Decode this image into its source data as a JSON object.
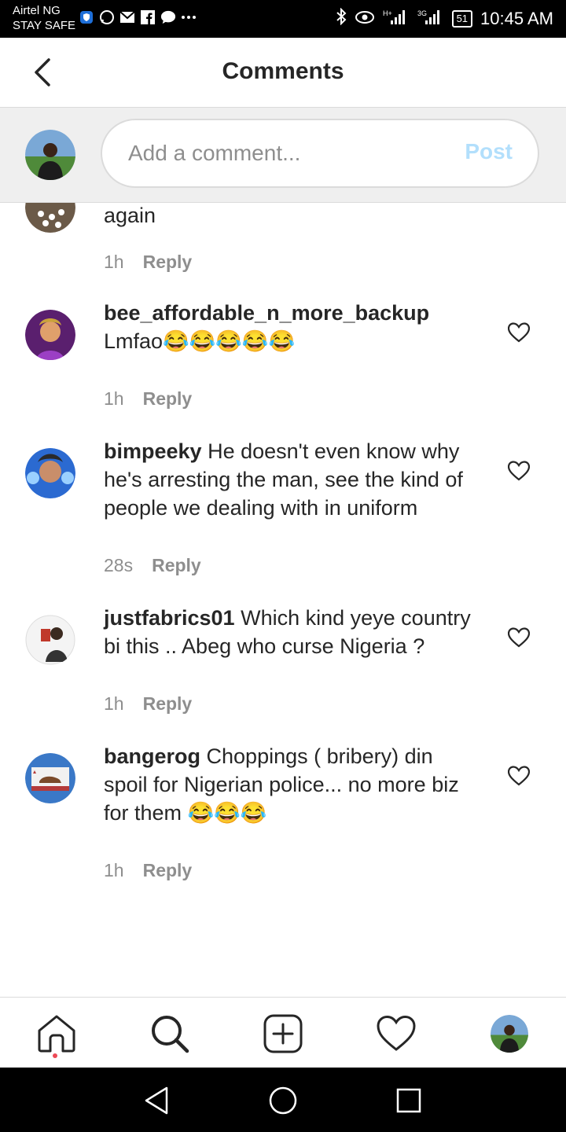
{
  "status_bar": {
    "carrier_line1": "Airtel NG",
    "carrier_line2": "STAY SAFE",
    "battery": "51",
    "time": "10:45 AM",
    "network_label": "3G"
  },
  "header": {
    "title": "Comments"
  },
  "composer": {
    "placeholder": "Add a comment...",
    "post_label": "Post"
  },
  "comments": [
    {
      "username": "",
      "text": "again",
      "time": "1h",
      "reply_label": "Reply",
      "avatar_color": "#5a4a3a"
    },
    {
      "username": "bee_affordable_n_more_backup",
      "text": "Lmfao😂😂😂😂😂",
      "time": "1h",
      "reply_label": "Reply",
      "avatar_color": "#7b2d8b"
    },
    {
      "username": "bimpeeky",
      "text": "He doesn't even know why he's arresting the man, see the kind of people we dealing with in uniform",
      "time": "28s",
      "reply_label": "Reply",
      "avatar_color": "#3a6fb5"
    },
    {
      "username": "justfabrics01",
      "text": "Which kind yeye country bi this .. Abeg who curse Nigeria ?",
      "time": "1h",
      "reply_label": "Reply",
      "avatar_color": "#c0392b"
    },
    {
      "username": "bangerog",
      "text": "Choppings ( bribery) din spoil for Nigerian police... no more biz for them 😂😂😂",
      "time": "1h",
      "reply_label": "Reply",
      "avatar_color": "#2c5a8a"
    }
  ],
  "colors": {
    "accent_post": "#b2dffc",
    "secondary_text": "#8e8e8e",
    "notification_dot": "#ed4956"
  }
}
